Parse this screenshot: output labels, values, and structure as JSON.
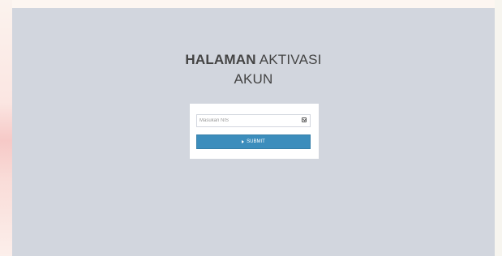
{
  "page": {
    "title_bold": "HALAMAN",
    "title_rest": " AKTIVASI",
    "title_line2": "AKUN"
  },
  "form": {
    "nis_field": {
      "placeholder": "Masukan NIS",
      "value": "",
      "icon": "id-card-icon"
    },
    "submit_button": {
      "label": "SUBMIT",
      "icon": "sign-in-icon"
    }
  },
  "colors": {
    "background": "#d2d6de",
    "card": "#ffffff",
    "button": "#3c8dbc",
    "button_text": "#ffffff",
    "title": "#444444"
  }
}
